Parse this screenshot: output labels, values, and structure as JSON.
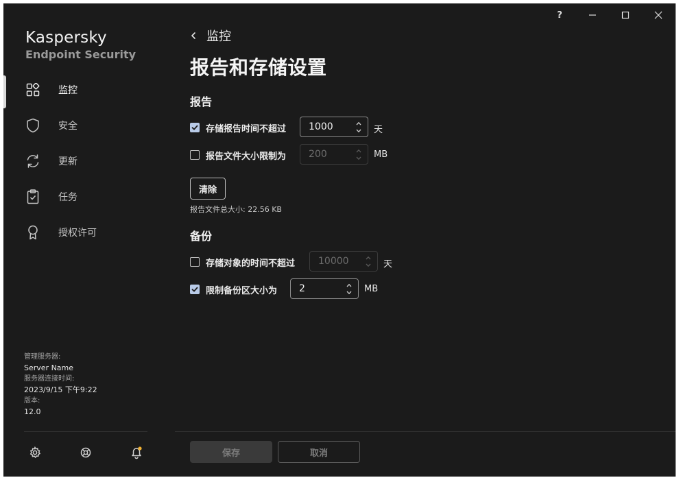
{
  "window": {
    "help_label": "?"
  },
  "brand": {
    "name": "Kaspersky",
    "product": "Endpoint Security"
  },
  "nav": {
    "items": [
      {
        "label": "监控",
        "icon": "dashboard-icon",
        "active": true
      },
      {
        "label": "安全",
        "icon": "shield-icon",
        "active": false
      },
      {
        "label": "更新",
        "icon": "refresh-icon",
        "active": false
      },
      {
        "label": "任务",
        "icon": "clipboard-check-icon",
        "active": false
      },
      {
        "label": "授权许可",
        "icon": "award-icon",
        "active": false
      }
    ]
  },
  "server_info": {
    "server_label": "管理服务器:",
    "server_value": "Server Name",
    "connection_label": "服务器连接时间:",
    "connection_value": "2023/9/15 下午9:22",
    "version_label": "版本:",
    "version_value": "12.0"
  },
  "footer_icons": [
    "gear-icon",
    "support-icon",
    "bell-icon"
  ],
  "main": {
    "breadcrumb": "监控",
    "title": "报告和存储设置",
    "reports": {
      "section_title": "报告",
      "store_time": {
        "label": "存储报告时间不超过",
        "checked": true,
        "value": "1000",
        "unit": "天",
        "enabled": true
      },
      "size_limit": {
        "label": "报告文件大小限制为",
        "checked": false,
        "value": "200",
        "unit": "MB",
        "enabled": false
      },
      "clear_label": "清除",
      "total_size": "报告文件总大小: 22.56 KB"
    },
    "backup": {
      "section_title": "备份",
      "store_time": {
        "label": "存储对象的时间不超过",
        "checked": false,
        "value": "10000",
        "unit": "天",
        "enabled": false
      },
      "size_limit": {
        "label": "限制备份区大小为",
        "checked": true,
        "value": "2",
        "unit": "MB",
        "enabled": true
      }
    },
    "actions": {
      "save_label": "保存",
      "cancel_label": "取消"
    }
  },
  "colors": {
    "background": "#1b1b1b",
    "checkbox_checked": "#b9cbe8",
    "notification_dot": "#f2b233"
  }
}
